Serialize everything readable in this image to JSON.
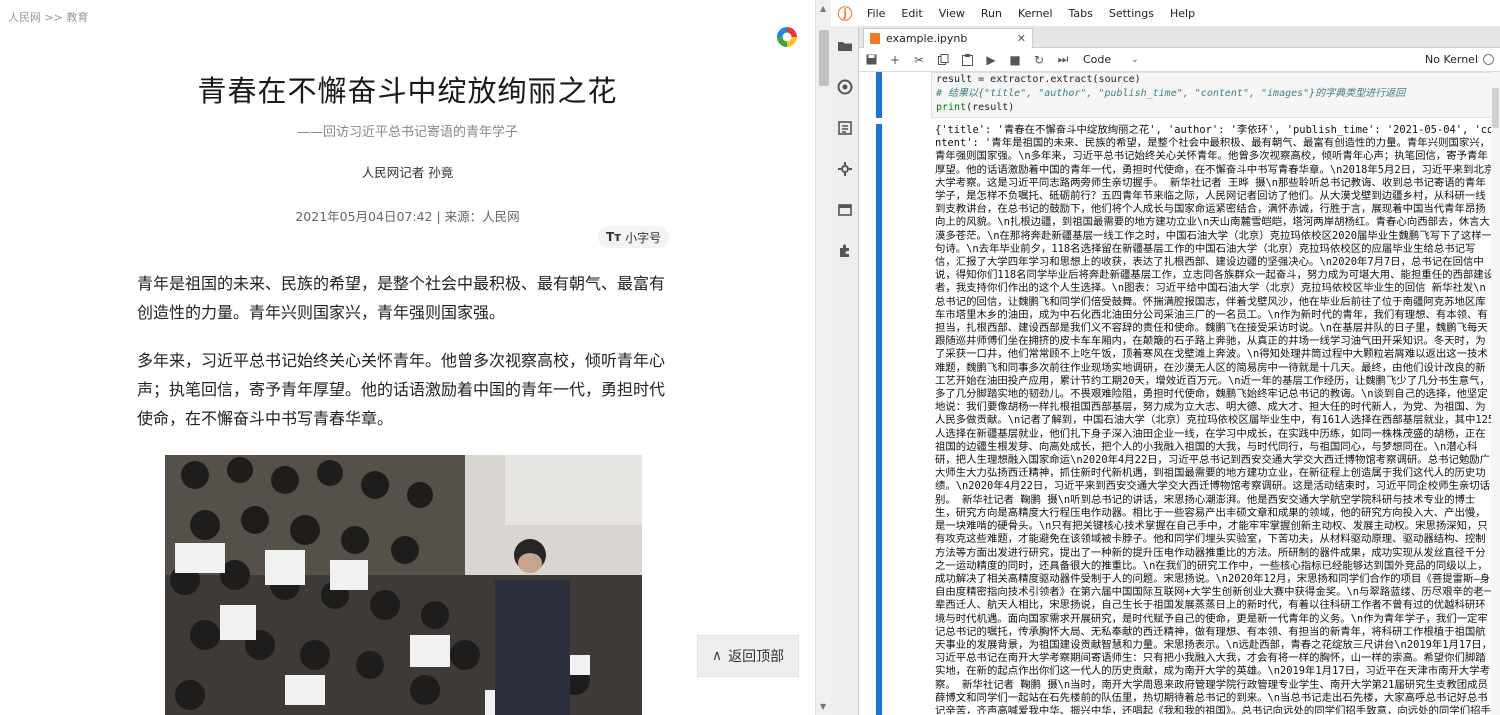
{
  "article": {
    "breadcrumb": "人民网 >> 教育",
    "title": "青春在不懈奋斗中绽放绚丽之花",
    "subtitle": "——回访习近平总书记寄语的青年学子",
    "author": "人民网记者 孙竟",
    "meta": "2021年05月04日07:42 | 来源：人民网",
    "font_size_label": "小字号",
    "paragraph1": "青年是祖国的未来、民族的希望，是整个社会中最积极、最有朝气、最富有创造性的力量。青年兴则国家兴，青年强则国家强。",
    "paragraph2": "多年来，习近平总书记始终关心关怀青年。他曾多次视察高校，倾听青年心声；执笔回信，寄予青年厚望。他的话语激励着中国的青年一代，勇担时代使命，在不懈奋斗中书写青春华章。",
    "back_to_top": "返回顶部"
  },
  "jupyter": {
    "menu": [
      "File",
      "Edit",
      "View",
      "Run",
      "Kernel",
      "Tabs",
      "Settings",
      "Help"
    ],
    "tab_title": "example.ipynb",
    "cell_type": "Code",
    "kernel": "No Kernel",
    "code_line1": "result = extractor.extract(source)",
    "code_line2": "# 结果以{\"title\", \"author\", \"publish_time\", \"content\", \"images\"}的字典类型进行返回",
    "code_line3_print": "print",
    "code_line3_rest": "(result)",
    "output": "{'title': '青春在不懈奋斗中绽放绚丽之花', 'author': '李依环', 'publish_time': '2021-05-04', 'content': '青年是祖国的未来、民族的希望，是整个社会中最积极、最有朝气、最富有创造性的力量。青年兴则国家兴，青年强则国家强。\\n多年来，习近平总书记始终关心关怀青年。他曾多次视察高校，倾听青年心声；执笔回信，寄予青年厚望。他的话语激励着中国的青年一代，勇担时代使命，在不懈奋斗中书写青春华章。\\n2018年5月2日，习近平来到北京大学考察。这是习近平同志路两旁师生亲切握手。 新华社记者 王晔 摄\\n那些聆听总书记教诲、收到总书记寄语的青年学子，是怎样不负嘱托、砥砺前行？五四青年节来临之际，人民网记者回访了他们。从大漠戈壁到边疆乡村，从科研一线到支教讲台，在总书记的鼓励下，他们将个人成长与国家命运紧密结合，满怀赤诚，行胜于言，展现着中国当代青年昂扬向上的风貌。\\n扎根边疆，到祖国最需要的地方建功立业\\n天山南麓雪皑皑，塔河两岸胡杨红。青春心向西部去，休言大漠多苍茫。\\n在那将奔赴新疆基层一线工作之时，中国石油大学（北京）克拉玛依校区2020届毕业生魏鹏飞写下了这样一句诗。\\n去年毕业前夕，118名选择留在新疆基层工作的中国石油大学（北京）克拉玛依校区的应届毕业生给总书记写信，汇报了大学四年学习和思想上的收获，表达了扎根西部、建设边疆的坚强决心。\\n2020年7月7日，总书记在回信中说，得知你们118名同学毕业后将奔赴新疆基层工作，立志同各族群众一起奋斗，努力成为可堪大用、能担重任的西部建设者，我支持你们作出的这个人生选择。\\n图表：习近平给中国石油大学（北京）克拉玛依校区毕业生的回信 新华社发\\n总书记的回信，让魏鹏飞和同学们倍受鼓舞。怀揣满腔报国志，伴着戈壁风沙，他在毕业后前往了位于南疆阿克苏地区库车市塔里木乡的油田，成为中石化西北油田分公司采油三厂的一名员工。\\n作为新时代的青年，我们有理想、有本领、有担当，扎根西部、建设西部是我们义不容辞的责任和使命。魏鹏飞在接受采访时说。\\n在基层井队的日子里，魏鹏飞每天跟随巡井师傅们坐在拥挤的皮卡车车厢内，在颠簸的石子路上奔驰，从真正的井场一线学习油气田开采知识。冬天时，为了采获一口井，他们常常顾不上吃午饭，顶着寒风在戈壁滩上奔波。\\n得知处理井筒过程中大颗粒岩屑难以返出这一技术难题，魏鹏飞和同事多次前往作业现场实地调研，在沙漠无人区的简易房中一待就是十几天。最终，由他们设计改良的新工艺开始在油田投产应用，累计节约工期20天，增效近百万元。\\n近一年的基层工作经历，让魏鹏飞少了几分书生意气，多了几分脚踏实地的韧劲儿。不畏艰难险阻，勇担时代使命，魏鹏飞始终牢记总书记的教诲。\\n谈到自己的选择，他坚定地说：我们要像胡杨一样扎根祖国西部基层，努力成为立大志、明大德、成大才、担大任的时代新人，为党、为祖国、为人民多做贡献。\\n记者了解到，中国石油大学（北京）克拉玛依校区届毕业生中，有161人选择在西部基层就业，其中125人选择在新疆基层就业，他们扎下身子深入油田企业一线，在学习中成长，在实践中历练，如同一株株茂盛的胡杨，正在祖国的边疆生根发芽、向高处成长，把个人的小我融入祖国的大我，与时代同行，与祖国同心，与梦想同在。\\n潜心科研，把人生理想融入国家命运\\n2020年4月22日，习近平总书记到西安交通大学交大西迁博物馆考察调研。总书记勉励广大师生大力弘扬西迁精神，抓住新时代新机遇，到祖国最需要的地方建功立业，在新征程上创造属于我们这代人的历史功绩。\\n2020年4月22日，习近平来到西安交通大学交大西迁博物馆考察调研。这是活动结束时，习近平同企校师生亲切话别。 新华社记者 鞠鹏 摄\\n听到总书记的讲话，宋思扬心潮澎湃。他是西安交通大学航空学院科研与技术专业的博士生，研究方向是高精度大行程压电作动器。相比于一些容易产出丰硕文章和成果的领域，他的研究方向投入大、产出慢，是一块难啃的硬骨头。\\n只有把关键核心技术掌握在自己手中，才能牢牢掌握创新主动权、发展主动权。宋思扬深知，只有攻克这些难题，才能避免在该领域被卡脖子。他和同学们埋头实验室，下苦功夫，从材料驱动原理、驱动器结构、控制方法等方面出发进行研究，提出了一种新的提升压电作动器推重比的方法。所研制的器件成果，成功实现从发丝直径千分之一运动精度的同时，还具备很大的推重比。\\n在我们的研究工作中，一些核心指标已经能够达到国外竞品的同级以上，成功解决了相关高精度驱动器件受制于人的问题。宋思扬说。\\n2020年12月，宋思扬和同学们合作的项目《菩提雷斯—身自由度精密指向技术引领者》在第六届中国国际互联网+大学生创新创业大赛中获得金奖。\\n与翠路蓝缕、历尽艰辛的老一辈西迁人、航天人相比，宋思扬说，自己生长于祖国发展蒸蒸日上的新时代，有着以往科研工作者不曾有过的优越科研环境与时代机遇。面向国家需求开展研究，是时代赋予自己的使命，更是新一代青年的义务。\\n作为青年学子，我们一定牢记总书记的嘱托，传承胸怀大局、无私奉献的西迁精神，做有理想、有本领、有担当的新青年，将科研工作根植于祖国航天事业的发展背景，为祖国建设贡献智慧和力量。宋思扬表示。\\n远赴西部，青春之花绽放三尺讲台\\n2019年1月17日，习近平总书记在南开大学考察期间寄语师生：只有把小我融入大我，才会有将一样的胸怀，山一样的崇高。希望你们脚踏实地，在新的起点作出你们这一代人的历史贡献，成为南开大学的英雄。\\n2019年1月17日，习近平在天津市南开大学考察。 新华社记者 鞠鹏 摄\\n当时，南开大学周恩来政府管理学院行政管理专业学生、南开大学第21届研究生支教团成员薛博文和同学们一起站在石先楼前的队伍里，热切期待着总书记的到来。\\n当总书记走出石先楼，大家高呼总书记好总书记辛苦，齐声高喊爱我中华、振兴中华，还唱起《我和我的祖国》。总书记向远处的同学们招手致意，向远处的同学们招手致意。掌声、歌声、欢呼声在校园里久久回荡。\\n回忆起两年前与总书记的见面，薛博文说，当看到总书记的身影，大家激动得热泪盈眶……'}"
  }
}
